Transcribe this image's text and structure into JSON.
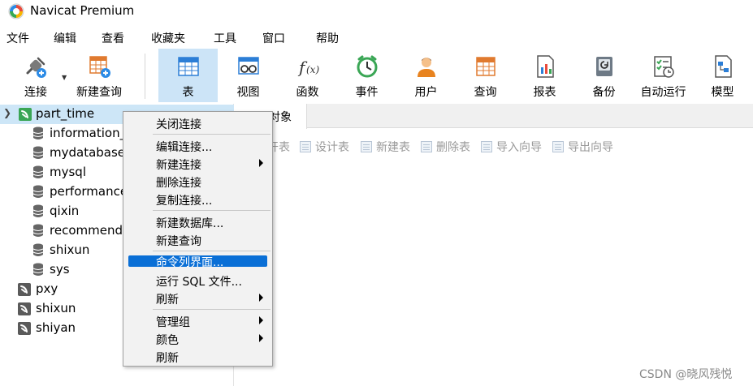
{
  "window": {
    "title": "Navicat Premium"
  },
  "menubar": [
    "文件",
    "编辑",
    "查看",
    "收藏夹",
    "工具",
    "窗口",
    "帮助"
  ],
  "toolbar": {
    "buttons": [
      {
        "label": "连接",
        "icon": "plug-icon"
      },
      {
        "label": "新建查询",
        "icon": "new-query-icon"
      },
      {
        "label": "表",
        "icon": "table-icon",
        "active": true
      },
      {
        "label": "视图",
        "icon": "view-icon"
      },
      {
        "label": "函数",
        "icon": "function-icon"
      },
      {
        "label": "事件",
        "icon": "clock-icon"
      },
      {
        "label": "用户",
        "icon": "user-icon"
      },
      {
        "label": "查询",
        "icon": "query-icon"
      },
      {
        "label": "报表",
        "icon": "report-icon"
      },
      {
        "label": "备份",
        "icon": "backup-icon"
      },
      {
        "label": "自动运行",
        "icon": "schedule-icon"
      },
      {
        "label": "模型",
        "icon": "model-icon"
      }
    ]
  },
  "tree": {
    "connections": [
      {
        "name": "part_time",
        "expanded": true,
        "databases": [
          "information_",
          "mydatabase",
          "mysql",
          "performance",
          "qixin",
          "recommend",
          "shixun",
          "sys"
        ]
      },
      {
        "name": "pxy"
      },
      {
        "name": "shixun"
      },
      {
        "name": "shiyan"
      }
    ]
  },
  "object_tab": {
    "label": "对象"
  },
  "object_toolbar": [
    "开表",
    "设计表",
    "新建表",
    "删除表",
    "导入向导",
    "导出向导"
  ],
  "context_menu": {
    "items": [
      {
        "label": "关闭连接"
      },
      {
        "label": "编辑连接..."
      },
      {
        "label": "新建连接",
        "submenu": true
      },
      {
        "label": "删除连接"
      },
      {
        "label": "复制连接..."
      },
      {
        "label": "新建数据库..."
      },
      {
        "label": "新建查询"
      },
      {
        "label": "命令列界面...",
        "highlighted": true
      },
      {
        "label": "运行 SQL 文件..."
      },
      {
        "label": "刷新",
        "submenu": true
      },
      {
        "label": "管理组",
        "submenu": true
      },
      {
        "label": "颜色",
        "submenu": true
      },
      {
        "label": "刷新"
      }
    ]
  },
  "watermark": "CSDN @晓风残悦",
  "colors": {
    "active_tab": "#cce4f7",
    "selection": "#cde6f7",
    "menu_highlight": "#0a6fd6",
    "connection_green": "#3aa655"
  }
}
